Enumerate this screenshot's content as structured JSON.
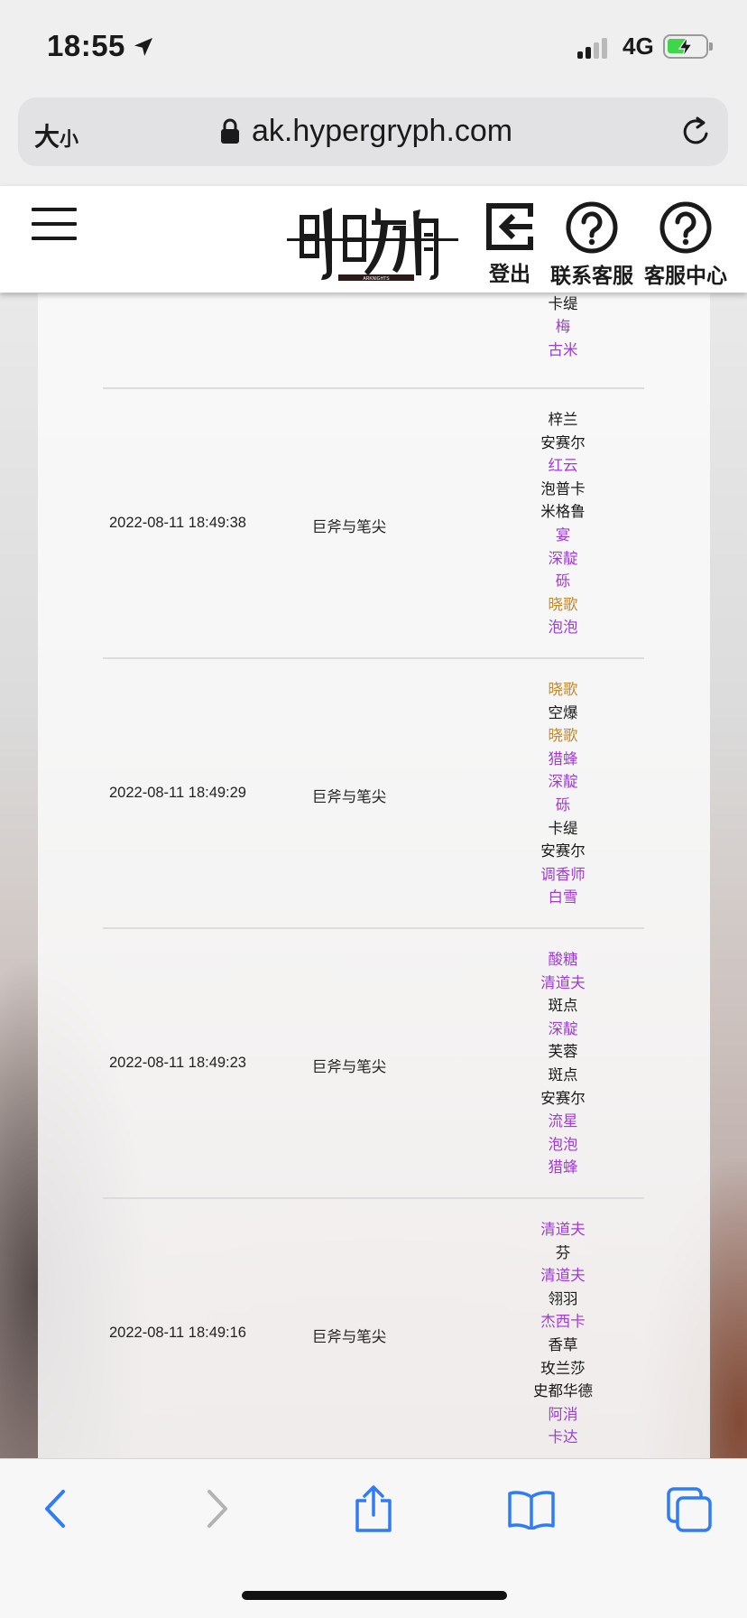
{
  "status_bar": {
    "time": "18:55",
    "network": "4G"
  },
  "browser": {
    "text_size_label_big": "大",
    "text_size_label_small": "小",
    "url": "ak.hypergryph.com"
  },
  "site_header": {
    "logout_label": "登出",
    "contact_label": "联系客服",
    "help_center_label": "客服中心"
  },
  "records": [
    {
      "time": "",
      "pool": "",
      "operators": [
        {
          "name": "卡缇",
          "rarity": 3
        },
        {
          "name": "梅",
          "rarity": 4
        },
        {
          "name": "古米",
          "rarity": 4
        }
      ]
    },
    {
      "time": "2022-08-11 18:49:38",
      "pool": "巨斧与笔尖",
      "operators": [
        {
          "name": "梓兰",
          "rarity": 3
        },
        {
          "name": "安赛尔",
          "rarity": 3
        },
        {
          "name": "红云",
          "rarity": 4
        },
        {
          "name": "泡普卡",
          "rarity": 3
        },
        {
          "name": "米格鲁",
          "rarity": 3
        },
        {
          "name": "宴",
          "rarity": 4
        },
        {
          "name": "深靛",
          "rarity": 4
        },
        {
          "name": "砾",
          "rarity": 4
        },
        {
          "name": "晓歌",
          "rarity": 5
        },
        {
          "name": "泡泡",
          "rarity": 4
        }
      ]
    },
    {
      "time": "2022-08-11 18:49:29",
      "pool": "巨斧与笔尖",
      "operators": [
        {
          "name": "晓歌",
          "rarity": 5
        },
        {
          "name": "空爆",
          "rarity": 3
        },
        {
          "name": "晓歌",
          "rarity": 5
        },
        {
          "name": "猎蜂",
          "rarity": 4
        },
        {
          "name": "深靛",
          "rarity": 4
        },
        {
          "name": "砾",
          "rarity": 4
        },
        {
          "name": "卡缇",
          "rarity": 3
        },
        {
          "name": "安赛尔",
          "rarity": 3
        },
        {
          "name": "调香师",
          "rarity": 4
        },
        {
          "name": "白雪",
          "rarity": 4
        }
      ]
    },
    {
      "time": "2022-08-11 18:49:23",
      "pool": "巨斧与笔尖",
      "operators": [
        {
          "name": "酸糖",
          "rarity": 4
        },
        {
          "name": "清道夫",
          "rarity": 4
        },
        {
          "name": "斑点",
          "rarity": 3
        },
        {
          "name": "深靛",
          "rarity": 4
        },
        {
          "name": "芙蓉",
          "rarity": 3
        },
        {
          "name": "斑点",
          "rarity": 3
        },
        {
          "name": "安赛尔",
          "rarity": 3
        },
        {
          "name": "流星",
          "rarity": 4
        },
        {
          "name": "泡泡",
          "rarity": 4
        },
        {
          "name": "猎蜂",
          "rarity": 4
        }
      ]
    },
    {
      "time": "2022-08-11 18:49:16",
      "pool": "巨斧与笔尖",
      "operators": [
        {
          "name": "清道夫",
          "rarity": 4
        },
        {
          "name": "芬",
          "rarity": 3
        },
        {
          "name": "清道夫",
          "rarity": 4
        },
        {
          "name": "翎羽",
          "rarity": 3
        },
        {
          "name": "杰西卡",
          "rarity": 4
        },
        {
          "name": "香草",
          "rarity": 3
        },
        {
          "name": "玫兰莎",
          "rarity": 3
        },
        {
          "name": "史都华德",
          "rarity": 3
        },
        {
          "name": "阿消",
          "rarity": 4
        },
        {
          "name": "卡达",
          "rarity": 4
        }
      ]
    }
  ]
}
